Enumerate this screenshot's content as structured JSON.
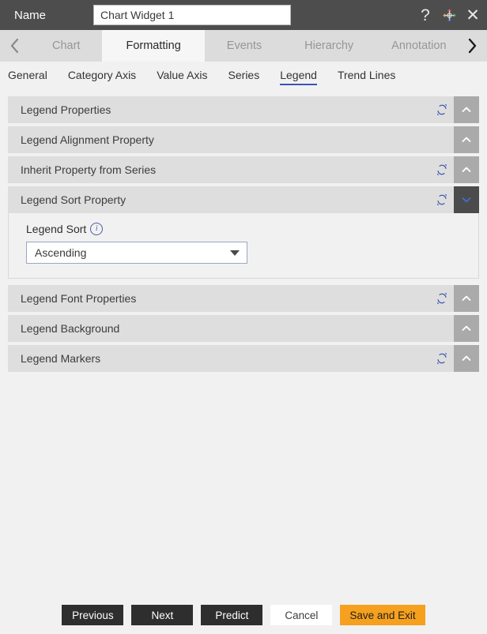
{
  "titlebar": {
    "name_label": "Name",
    "name_value": "Chart Widget 1",
    "name_placeholder": "Chart Widget 1",
    "help_glyph": "?",
    "close_glyph": "✕"
  },
  "tabstrip": {
    "prev_arrow": "‹",
    "next_arrow": "›",
    "tabs": [
      {
        "label": "Chart",
        "active": false
      },
      {
        "label": "Formatting",
        "active": true
      },
      {
        "label": "Events",
        "active": false
      },
      {
        "label": "Hierarchy",
        "active": false
      },
      {
        "label": "Annotation",
        "active": false
      }
    ]
  },
  "subtabs": [
    {
      "label": "General",
      "active": false
    },
    {
      "label": "Category Axis",
      "active": false
    },
    {
      "label": "Value Axis",
      "active": false
    },
    {
      "label": "Series",
      "active": false
    },
    {
      "label": "Legend",
      "active": true
    },
    {
      "label": "Trend Lines",
      "active": false
    }
  ],
  "accordion": [
    {
      "title": "Legend Properties",
      "refresh": true,
      "expanded": false
    },
    {
      "title": "Legend Alignment Property",
      "refresh": false,
      "expanded": false
    },
    {
      "title": "Inherit Property from Series",
      "refresh": true,
      "expanded": false
    },
    {
      "title": "Legend Sort Property",
      "refresh": true,
      "expanded": true
    },
    {
      "title": "Legend Font Properties",
      "refresh": true,
      "expanded": false
    },
    {
      "title": "Legend Background",
      "refresh": false,
      "expanded": false
    },
    {
      "title": "Legend Markers",
      "refresh": true,
      "expanded": false
    }
  ],
  "legend_sort": {
    "label": "Legend Sort",
    "info_glyph": "i",
    "selected": "Ascending",
    "options": [
      "Ascending"
    ]
  },
  "footer": {
    "buttons": [
      {
        "label": "Previous",
        "style": "dark"
      },
      {
        "label": "Next",
        "style": "dark"
      },
      {
        "label": "Predict",
        "style": "dark"
      },
      {
        "label": "Cancel",
        "style": "light"
      },
      {
        "label": "Save and Exit",
        "style": "accent"
      }
    ]
  },
  "colors": {
    "titlebar_bg": "#4d4d4d",
    "tabstrip_bg": "#dcdcdc",
    "active_tab_bg": "#f6f6f6",
    "accordion_header_bg": "#dedede",
    "toggle_bg": "#aaaaaa",
    "toggle_open_bg": "#4b4b4b",
    "accent_underline": "#3f51b5",
    "refresh_icon": "#3f5bb5",
    "save_button": "#f5a01e",
    "page_bg": "#f1f1f1"
  }
}
